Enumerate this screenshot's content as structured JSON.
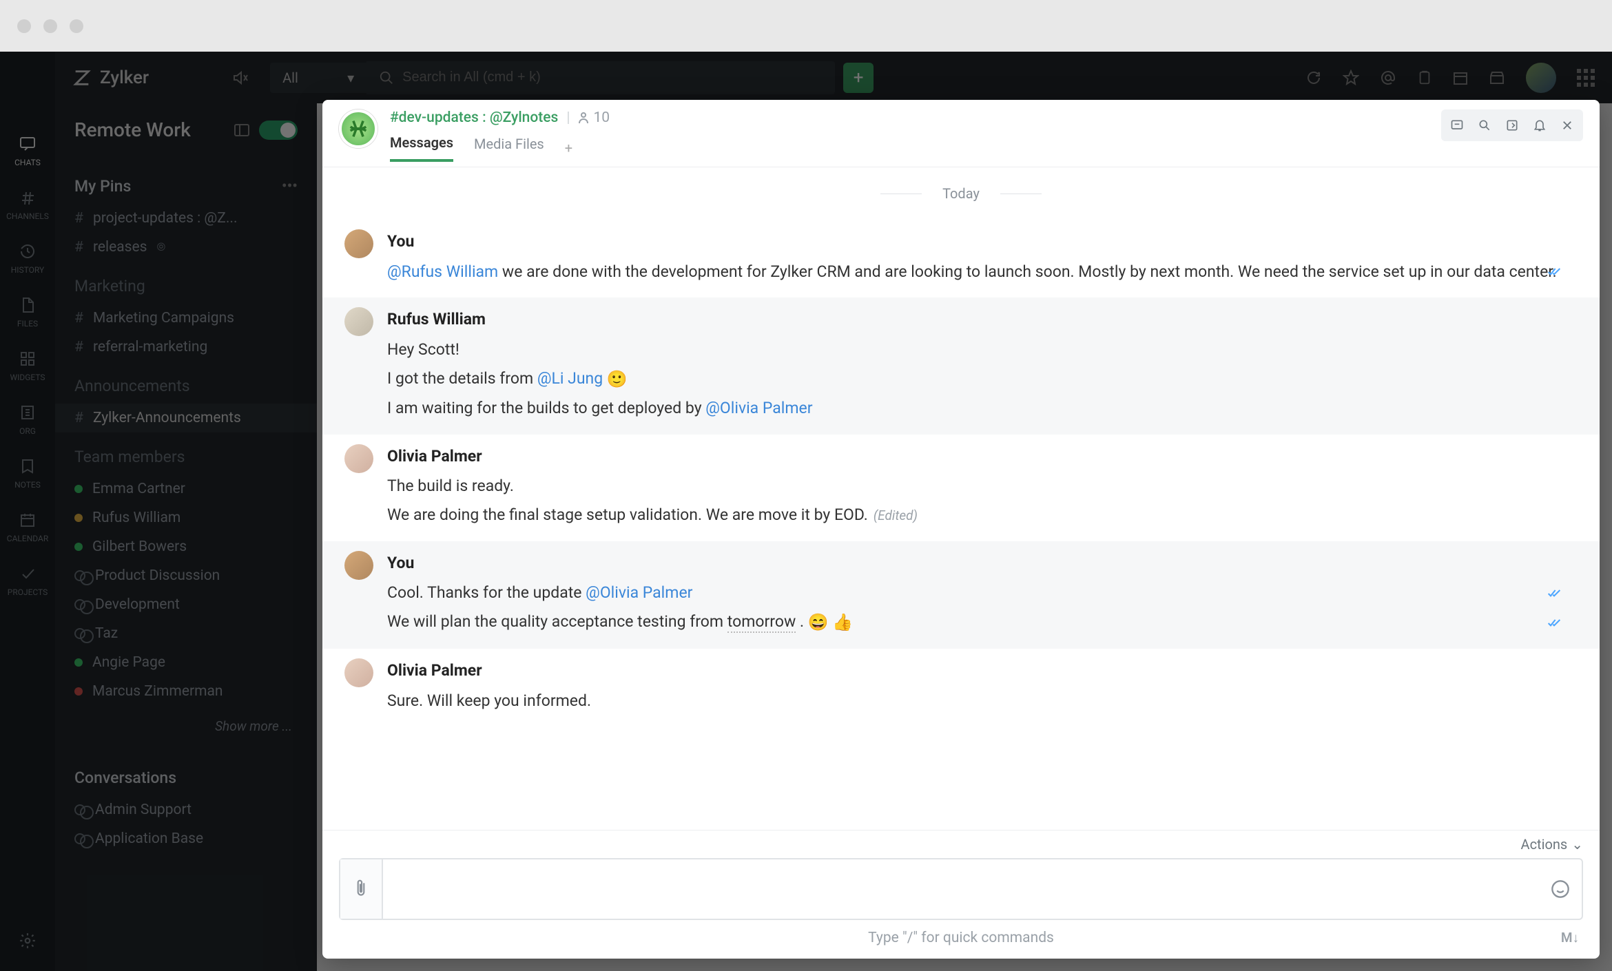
{
  "topbar": {
    "brand": "Zylker",
    "scope": "All",
    "search_placeholder": "Search in All (cmd + k)"
  },
  "rail": {
    "chats": "CHATS",
    "channels": "CHANNELS",
    "history": "HISTORY",
    "files": "FILES",
    "widgets": "WIDGETS",
    "org": "ORG",
    "notes": "NOTES",
    "calendar": "CALENDAR",
    "projects": "PROJECTS"
  },
  "sidebar": {
    "title": "Remote Work",
    "pins_title": "My Pins",
    "pins": [
      "project-updates : @Z...",
      "releases"
    ],
    "marketing_title": "Marketing",
    "marketing": [
      "Marketing Campaigns",
      "referral-marketing"
    ],
    "announcements_title": "Announcements",
    "announcements": [
      "Zylker-Announcements"
    ],
    "team_title": "Team members",
    "team": [
      {
        "name": "Emma  Cartner",
        "status": "green"
      },
      {
        "name": "Rufus William",
        "status": "yellow"
      },
      {
        "name": "Gilbert Bowers",
        "status": "green"
      },
      {
        "name": "Product Discussion",
        "status": "group"
      },
      {
        "name": "Development",
        "status": "group"
      },
      {
        "name": "Taz",
        "status": "group"
      },
      {
        "name": "Angie Page",
        "status": "green"
      },
      {
        "name": "Marcus Zimmerman",
        "status": "red"
      }
    ],
    "show_more": "Show more ...",
    "conversations_title": "Conversations",
    "conversations": [
      "Admin Support",
      "Application Base"
    ]
  },
  "chat": {
    "channel_name": "#dev-updates : @Zylnotes",
    "member_count": "10",
    "tabs": {
      "messages": "Messages",
      "media": "Media Files"
    },
    "date": "Today",
    "messages": [
      {
        "author": "You",
        "grey": false,
        "av": 1,
        "lines": [
          {
            "parts": [
              {
                "t": "mention",
                "v": "@Rufus William"
              },
              {
                "t": "text",
                "v": " we are done with the development for Zylker CRM and are looking to launch soon. Mostly by next month. We need the service set up in our data center."
              }
            ],
            "ticks": true
          }
        ]
      },
      {
        "author": "Rufus William",
        "grey": true,
        "av": 2,
        "lines": [
          {
            "parts": [
              {
                "t": "text",
                "v": "Hey Scott!"
              }
            ]
          },
          {
            "parts": [
              {
                "t": "text",
                "v": "I got the details from "
              },
              {
                "t": "mention",
                "v": "@Li Jung"
              },
              {
                "t": "text",
                "v": "  "
              },
              {
                "t": "emoji",
                "v": "🙂"
              }
            ]
          },
          {
            "parts": [
              {
                "t": "text",
                "v": "I am waiting for the builds to get deployed by "
              },
              {
                "t": "mention",
                "v": "@Olivia Palmer"
              }
            ]
          }
        ]
      },
      {
        "author": "Olivia Palmer",
        "grey": false,
        "av": 3,
        "lines": [
          {
            "parts": [
              {
                "t": "text",
                "v": "The build is ready."
              }
            ]
          },
          {
            "parts": [
              {
                "t": "text",
                "v": "We are doing the final stage setup validation. We are move it by EOD."
              }
            ],
            "edited": "(Edited)"
          }
        ]
      },
      {
        "author": "You",
        "grey": true,
        "av": 1,
        "lines": [
          {
            "parts": [
              {
                "t": "text",
                "v": "Cool. Thanks for the update "
              },
              {
                "t": "mention",
                "v": "@Olivia Palmer"
              }
            ],
            "ticks": true
          },
          {
            "parts": [
              {
                "t": "text",
                "v": "We will plan the quality acceptance testing from  "
              },
              {
                "t": "underline",
                "v": "tomorrow"
              },
              {
                "t": "text",
                "v": " .  "
              },
              {
                "t": "emoji",
                "v": "😄"
              },
              {
                "t": "text",
                "v": "  "
              },
              {
                "t": "emoji",
                "v": "👍"
              }
            ],
            "ticks": true
          }
        ]
      },
      {
        "author": "Olivia Palmer",
        "grey": false,
        "av": 3,
        "lines": [
          {
            "parts": [
              {
                "t": "text",
                "v": "Sure. Will keep you informed."
              }
            ]
          }
        ]
      }
    ],
    "actions_label": "Actions",
    "composer_placeholder": "",
    "hint": "Type \"/\" for quick commands",
    "md_badge": "M↓"
  }
}
